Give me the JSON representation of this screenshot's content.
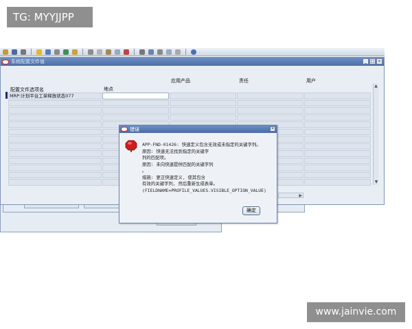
{
  "tag_label": "TG: MYYJJPP",
  "watermark": "www.jainvie.com",
  "main_window": {
    "title": "系统配置文件值",
    "columns": {
      "profile_option": "配置文件选项名",
      "site": "地点",
      "application": "应用产品",
      "responsibility": "责任",
      "user": "用户"
    },
    "first_row_profile": "MRP:计划平台工单释放状态077"
  },
  "dialog": {
    "title": "错误",
    "lines": [
      "APP-FND-01426: 快速定义包含无效或未指定的关键字列。",
      "原因: 快速无法找到指定的关键字",
      "列的匹配项。",
      "原因: 未向快速提供匹配的关键字列",
      "。",
      "措施: 更正快速定义, 使其包含",
      "有效的关键字列, 然后重新生成表单。",
      "(FIELDNAME=PROFILE_VALUES.VISIBLE_OPTION_VALUE)"
    ],
    "ok_label": "确定"
  }
}
